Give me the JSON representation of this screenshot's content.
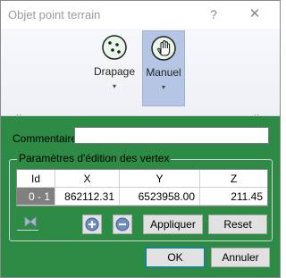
{
  "window": {
    "title": "Objet point terrain",
    "help_glyph": "?",
    "close_glyph": "✕"
  },
  "ribbon": {
    "buttons": [
      {
        "label": "Drapage",
        "caret": "▾",
        "icon": "dots-circle-icon",
        "selected": false
      },
      {
        "label": "Manuel",
        "caret": "▾",
        "icon": "hand-cursor-icon",
        "selected": true
      }
    ],
    "corner_left": "..",
    "corner_right": ".."
  },
  "comment": {
    "label": "Commentaire",
    "value": ""
  },
  "vertex_group": {
    "title": "Paramètres d'édition des vertex",
    "columns": [
      "Id",
      "X",
      "Y",
      "Z"
    ],
    "rows": [
      [
        "0 - 1",
        "862112.31",
        "6523958.00",
        "211.45"
      ]
    ]
  },
  "actions": {
    "add_icon": "plus-circle-icon",
    "remove_icon": "minus-circle-icon",
    "apply_label": "Appliquer",
    "reset_label": "Reset"
  },
  "footer": {
    "ok_label": "OK",
    "cancel_label": "Annuler"
  },
  "colors": {
    "dialog_body": "#2e8b45",
    "ribbon_selected": "#b4c6e4",
    "grid_row_header": "#808080"
  }
}
